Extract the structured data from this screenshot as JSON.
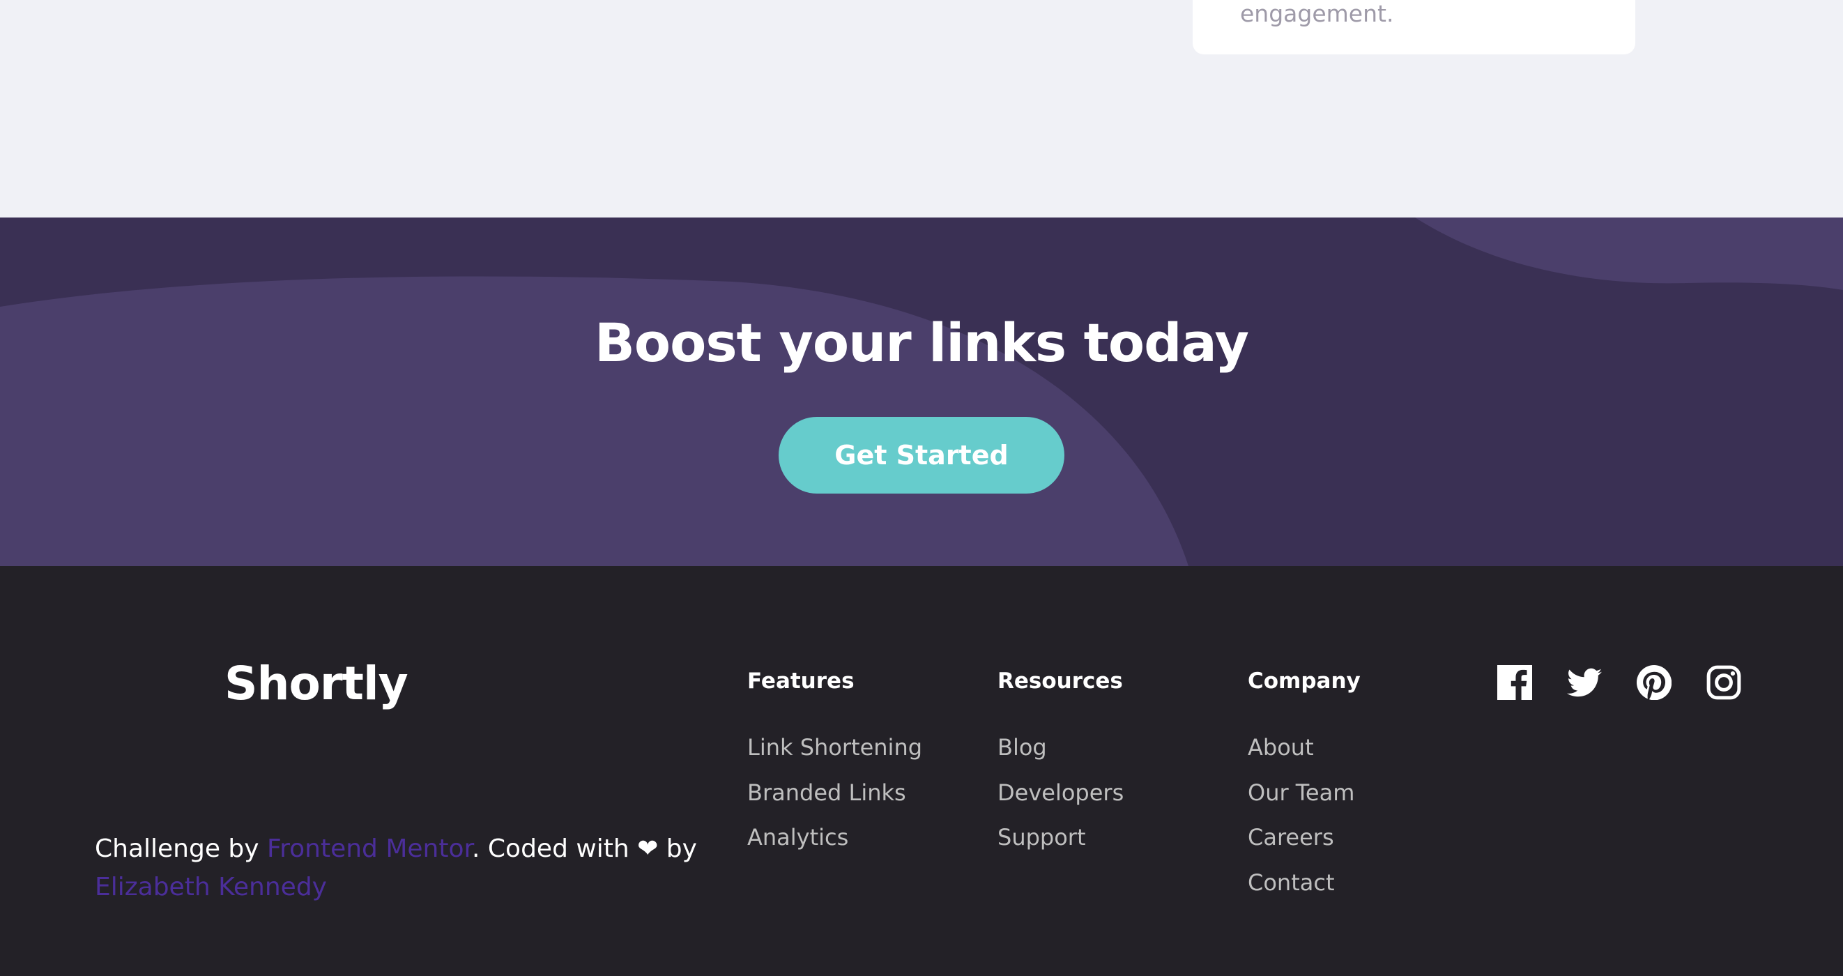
{
  "stat_card": {
    "text": "engagement."
  },
  "boost": {
    "title": "Boost your links today",
    "button_label": "Get Started"
  },
  "footer": {
    "logo": "Shortly",
    "columns": [
      {
        "title": "Features",
        "links": [
          "Link Shortening",
          "Branded Links",
          "Analytics"
        ]
      },
      {
        "title": "Resources",
        "links": [
          "Blog",
          "Developers",
          "Support"
        ]
      },
      {
        "title": "Company",
        "links": [
          "About",
          "Our Team",
          "Careers",
          "Contact"
        ]
      }
    ],
    "socials": [
      "facebook-icon",
      "twitter-icon",
      "pinterest-icon",
      "instagram-icon"
    ],
    "attribution": {
      "prefix": "Challenge by ",
      "link1": "Frontend Mentor",
      "middle": ". Coded with ❤ by",
      "link2": "Elizabeth Kennedy"
    }
  },
  "colors": {
    "boost_bg": "#3a3054",
    "boost_shape": "#4b3f6b",
    "accent": "#66cccc",
    "footer_bg": "#232127",
    "link_purple": "#4b2e9a"
  }
}
